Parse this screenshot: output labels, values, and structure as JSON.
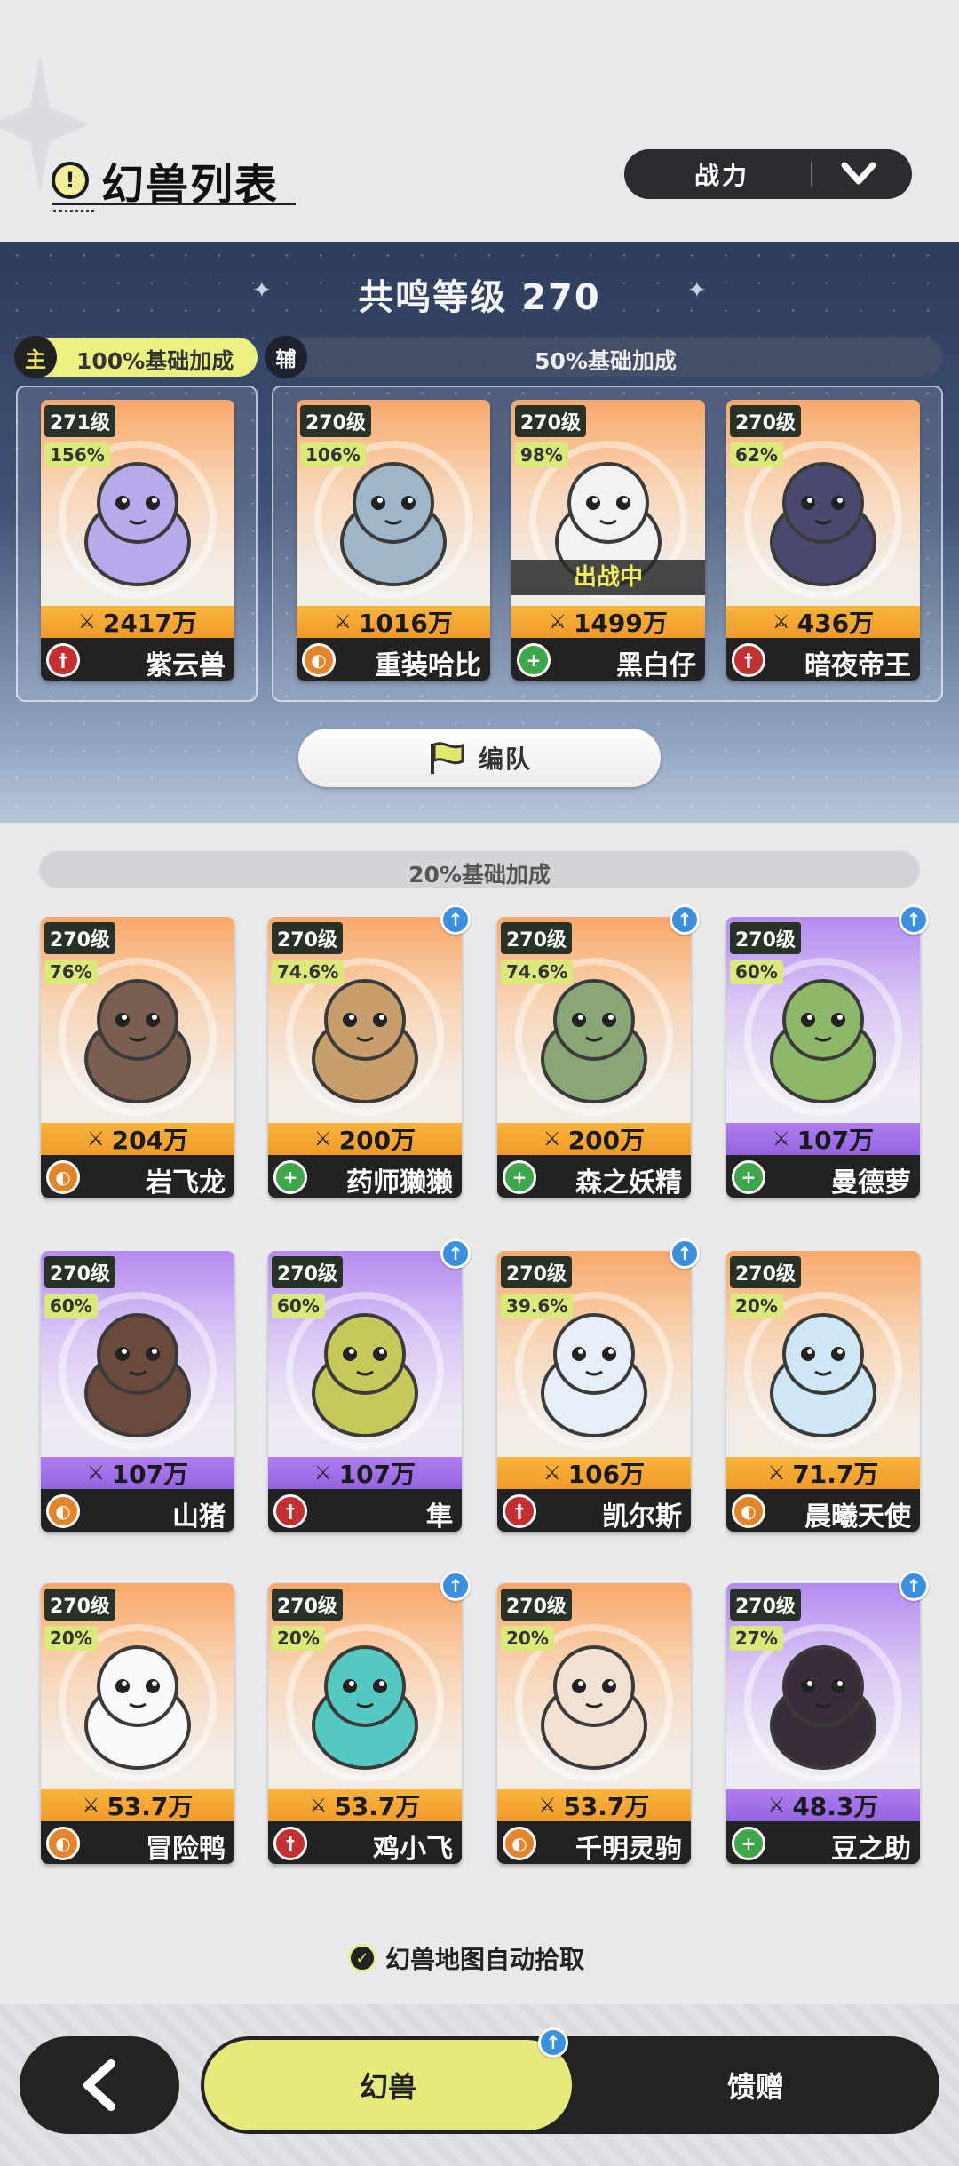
{
  "header": {
    "title": "幻兽列表",
    "sort_label": "战力"
  },
  "resonance": {
    "title": "共鸣等级 270",
    "main_badge": "主",
    "main_bonus": "100%基础加成",
    "assist_badge": "辅",
    "assist_bonus": "50%基础加成",
    "formation_label": "编队",
    "deployed_label": "出战中",
    "cards": [
      {
        "level": "271级",
        "pct": "156%",
        "power": "2417万",
        "name": "紫云兽",
        "role": "atk",
        "color": "orange"
      },
      {
        "level": "270级",
        "pct": "106%",
        "power": "1016万",
        "name": "重装哈比",
        "role": "def",
        "color": "orange"
      },
      {
        "level": "270级",
        "pct": "98%",
        "power": "1499万",
        "name": "黑白仔",
        "role": "sup",
        "color": "orange"
      },
      {
        "level": "270级",
        "pct": "62%",
        "power": "436万",
        "name": "暗夜帝王",
        "role": "atk",
        "color": "orange"
      }
    ]
  },
  "list": {
    "bonus_label": "20%基础加成",
    "cards": [
      {
        "level": "270级",
        "pct": "76%",
        "power": "204万",
        "name": "岩飞龙",
        "role": "def",
        "color": "orange",
        "upgrade": false
      },
      {
        "level": "270级",
        "pct": "74.6%",
        "power": "200万",
        "name": "药师獭獭",
        "role": "sup",
        "color": "orange",
        "upgrade": true
      },
      {
        "level": "270级",
        "pct": "74.6%",
        "power": "200万",
        "name": "森之妖精",
        "role": "sup",
        "color": "orange",
        "upgrade": true
      },
      {
        "level": "270级",
        "pct": "60%",
        "power": "107万",
        "name": "曼德萝",
        "role": "sup",
        "color": "purple",
        "upgrade": true
      },
      {
        "level": "270级",
        "pct": "60%",
        "power": "107万",
        "name": "山猪",
        "role": "def",
        "color": "purple",
        "upgrade": false
      },
      {
        "level": "270级",
        "pct": "60%",
        "power": "107万",
        "name": "隼",
        "role": "atk",
        "color": "purple",
        "upgrade": true
      },
      {
        "level": "270级",
        "pct": "39.6%",
        "power": "106万",
        "name": "凯尔斯",
        "role": "atk",
        "color": "orange",
        "upgrade": true
      },
      {
        "level": "270级",
        "pct": "20%",
        "power": "71.7万",
        "name": "晨曦天使",
        "role": "def",
        "color": "orange",
        "upgrade": false
      },
      {
        "level": "270级",
        "pct": "20%",
        "power": "53.7万",
        "name": "冒险鸭",
        "role": "def",
        "color": "orange",
        "upgrade": false
      },
      {
        "level": "270级",
        "pct": "20%",
        "power": "53.7万",
        "name": "鸡小飞",
        "role": "atk",
        "color": "orange",
        "upgrade": true
      },
      {
        "level": "270级",
        "pct": "20%",
        "power": "53.7万",
        "name": "千明灵驹",
        "role": "def",
        "color": "orange",
        "upgrade": false
      },
      {
        "level": "270级",
        "pct": "27%",
        "power": "48.3万",
        "name": "豆之助",
        "role": "sup",
        "color": "purple",
        "upgrade": true
      }
    ]
  },
  "auto_pickup": {
    "label": "幻兽地图自动拾取",
    "checked": true
  },
  "nav": {
    "active_label": "幻兽",
    "other_label": "馈赠"
  },
  "colors": {
    "accent": "#e6ea7c",
    "dark": "#232323",
    "upgrade": "#3a8fe0"
  }
}
